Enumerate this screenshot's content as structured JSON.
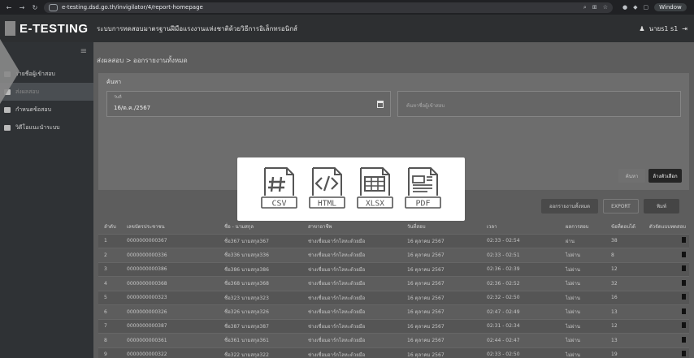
{
  "browser": {
    "url": "e-testing.dsd.go.th/invigilator/4/report-homepage",
    "profile_label": "Window"
  },
  "header": {
    "logo": "E-TESTING",
    "title": "ระบบการทดสอบมาตรฐานฝีมือแรงงานแห่งชาติด้วยวิธีการอิเล็กทรอนิกส์",
    "user": "นายs1 s1"
  },
  "sidebar": {
    "items": [
      {
        "label": "รายชื่อผู้เข้าสอบ"
      },
      {
        "label": "ส่งผลสอบ"
      },
      {
        "label": "กำหนดข้อสอบ"
      },
      {
        "label": "วิดีโอแนะนำระบบ"
      }
    ]
  },
  "main": {
    "breadcrumb": "ส่งผลสอบ > ออกรายงานทั้งหมด",
    "search_title": "ค้นหา",
    "date_label": "วันที่",
    "date_value": "16/ต.ค./2567",
    "name_placeholder": "ค้นหาชื่อผู้เข้าสอบ",
    "search_button": "ค้นหา",
    "clear_button": "ล้างตัวเลือก",
    "report_all_button": "ออกรายงานทั้งหมด",
    "export_button": "EXPORT",
    "print_button": "พิมพ์"
  },
  "table": {
    "headers": [
      "ลำดับ",
      "เลขบัตรประชาชน",
      "ชื่อ - นามสกุล",
      "สาขาอาชีพ",
      "วันที่สอบ",
      "เวลา",
      "ผลการสอบ",
      "ข้อที่ตอบได้",
      "ตัวจัดแบบทดสอบ"
    ],
    "rows": [
      [
        "1",
        "0000000000367",
        "ชื่อ367 นามสกุล367",
        "ช่างเชื่อมอาร์กโลหะด้วยมือ",
        "16 ตุลาคม 2567",
        "02:33 - 02:54",
        "ผ่าน",
        "38"
      ],
      [
        "2",
        "0000000000336",
        "ชื่อ336 นามสกุล336",
        "ช่างเชื่อมอาร์กโลหะด้วยมือ",
        "16 ตุลาคม 2567",
        "02:33 - 02:51",
        "ไม่ผ่าน",
        "8"
      ],
      [
        "3",
        "0000000000386",
        "ชื่อ386 นามสกุล386",
        "ช่างเชื่อมอาร์กโลหะด้วยมือ",
        "16 ตุลาคม 2567",
        "02:36 - 02:39",
        "ไม่ผ่าน",
        "12"
      ],
      [
        "4",
        "0000000000368",
        "ชื่อ368 นามสกุล368",
        "ช่างเชื่อมอาร์กโลหะด้วยมือ",
        "16 ตุลาคม 2567",
        "02:36 - 02:52",
        "ไม่ผ่าน",
        "32"
      ],
      [
        "5",
        "0000000000323",
        "ชื่อ323 นามสกุล323",
        "ช่างเชื่อมอาร์กโลหะด้วยมือ",
        "16 ตุลาคม 2567",
        "02:32 - 02:50",
        "ไม่ผ่าน",
        "16"
      ],
      [
        "6",
        "0000000000326",
        "ชื่อ326 นามสกุล326",
        "ช่างเชื่อมอาร์กโลหะด้วยมือ",
        "16 ตุลาคม 2567",
        "02:47 - 02:49",
        "ไม่ผ่าน",
        "13"
      ],
      [
        "7",
        "0000000000387",
        "ชื่อ387 นามสกุล387",
        "ช่างเชื่อมอาร์กโลหะด้วยมือ",
        "16 ตุลาคม 2567",
        "02:31 - 02:34",
        "ไม่ผ่าน",
        "12"
      ],
      [
        "8",
        "0000000000361",
        "ชื่อ361 นามสกุล361",
        "ช่างเชื่อมอาร์กโลหะด้วยมือ",
        "16 ตุลาคม 2567",
        "02:44 - 02:47",
        "ไม่ผ่าน",
        "13"
      ],
      [
        "9",
        "0000000000322",
        "ชื่อ322 นามสกุล322",
        "ช่างเชื่อมอาร์กโลหะด้วยมือ",
        "16 ตุลาคม 2567",
        "02:33 - 02:50",
        "ไม่ผ่าน",
        "19"
      ],
      [
        "10",
        "7946108859538",
        "ทดสอบ05 แอป",
        "ช่างเชื่อมอาร์กโลหะด้วยมือ",
        "16 ตุลาคม 2567",
        "04:32 - 04:37",
        "ไม่ผ่าน",
        "10"
      ]
    ]
  },
  "export_modal": {
    "options": [
      {
        "label": "CSV",
        "icon": "csv-icon"
      },
      {
        "label": "HTML",
        "icon": "html-icon"
      },
      {
        "label": "XLSX",
        "icon": "xlsx-icon"
      },
      {
        "label": "PDF",
        "icon": "pdf-icon"
      }
    ]
  },
  "colors": {
    "modal_icon": "#555555",
    "header_bg": "#2d2f31",
    "sidebar_bg": "#2f3235"
  }
}
